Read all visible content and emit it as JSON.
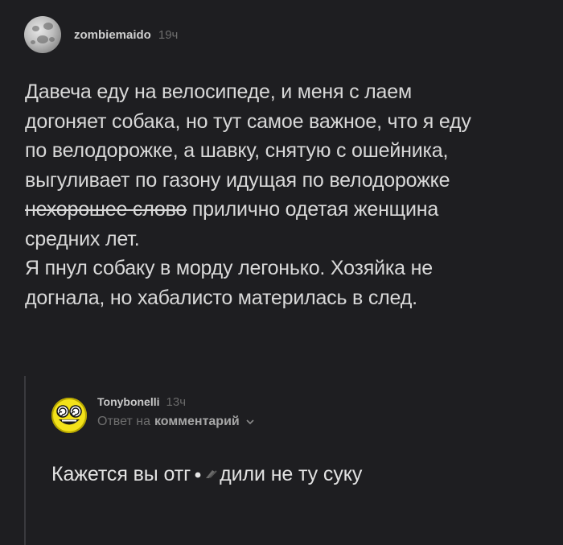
{
  "post": {
    "username": "zombiemaido",
    "time": "19ч",
    "line1": "Давеча еду на велосипеде, и меня с лаем",
    "line2": "догоняет собака, но тут самое важное, что я еду",
    "line3": "по велодорожке, а шавку, снятую с ошейника,",
    "line4": "выгуливает по газону идущая по велодорожке",
    "line5_struck": "нехорошее слово",
    "line5_rest": " прилично одетая женщина",
    "line6": "средних лет.",
    "line7": "Я пнул собаку в морду легонько. Хозяйка не",
    "line8": "догнала, но хабалисто материлась в след."
  },
  "reply": {
    "username": "Tonybonelli",
    "time": "13ч",
    "reply_to_prefix": "Ответ на",
    "reply_to_link": "комментарий",
    "text_before": "Кажется вы отг",
    "text_after": "дили не ту суку"
  },
  "colors": {
    "background": "#1e1e21",
    "text": "#d8d8d8",
    "muted": "#6e6e6e",
    "smiley": "#f3e21a"
  },
  "icons": {
    "post_avatar": "moon-avatar-icon",
    "reply_avatar": "smiley-avatar-icon",
    "reply_chevron": "chevron-down-icon"
  }
}
